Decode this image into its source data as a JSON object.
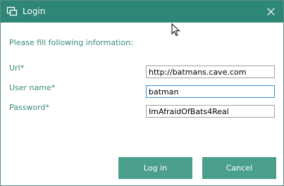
{
  "window": {
    "title": "Login",
    "icon": "app-window-icon",
    "close_icon": "close-icon"
  },
  "form": {
    "instruction": "Please fill following information:",
    "url_label": "Url*",
    "url_value": "http://batmans.cave.com",
    "username_label": "User name*",
    "username_value": "batman",
    "password_label": "Password*",
    "password_value": "ImAfraidOfBats4Real"
  },
  "buttons": {
    "login_label": "Log in",
    "cancel_label": "Cancel"
  },
  "colors": {
    "titlebar": "#2e8676",
    "accent_text": "#3a8b7c",
    "button": "#4a9f8d",
    "focus_border": "#3e8fc8"
  }
}
